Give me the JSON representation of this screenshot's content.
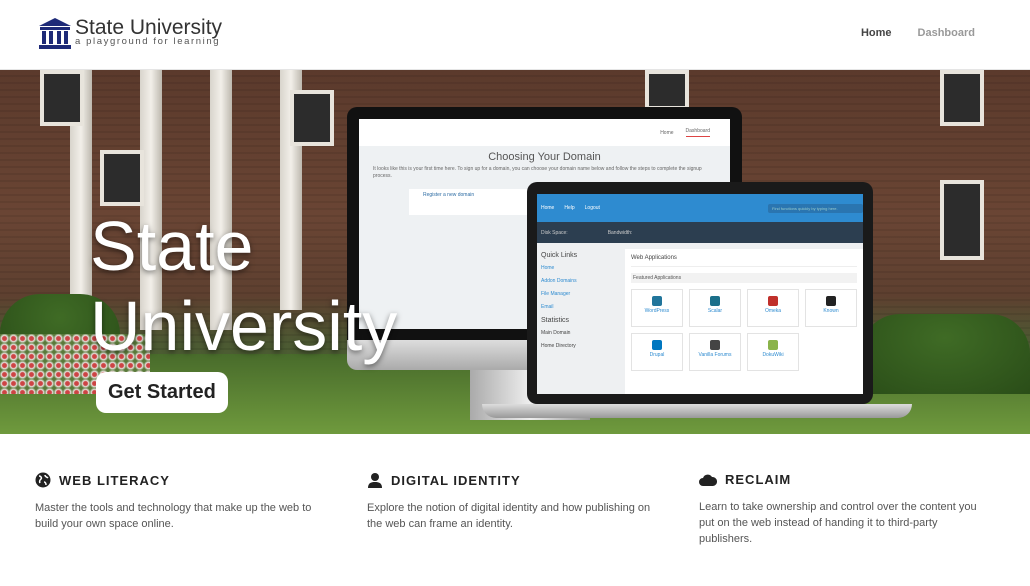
{
  "header": {
    "logo": {
      "title": "State University",
      "subtitle": "a playground for learning",
      "color": "#1e2a78"
    },
    "nav": [
      {
        "label": "Home",
        "active": true
      },
      {
        "label": "Dashboard",
        "active": false
      }
    ]
  },
  "hero": {
    "title_line1": "State",
    "title_line2": "University",
    "cta_label": "Get Started",
    "monitor": {
      "nav": [
        "Home",
        "Dashboard"
      ],
      "title": "Choosing Your Domain",
      "intro": "It looks like this is your first time here. To sign up for a domain, you can choose your domain name below and follow the steps to complete the signup process.",
      "option": "Register a new domain"
    },
    "laptop": {
      "nav": [
        "Home",
        "Help",
        "Logout"
      ],
      "search_placeholder": "Find functions quickly by typing here.",
      "disk_label": "Disk Space:",
      "bandwidth_label": "Bandwidth:",
      "quick_links_title": "Quick Links",
      "quick_links": [
        "Home",
        "Addon Domains",
        "File Manager",
        "Email"
      ],
      "statistics_title": "Statistics",
      "main_domain_label": "Main Domain",
      "home_directory_label": "Home Directory",
      "apps_title": "Web Applications",
      "featured_label": "Featured Applications",
      "apps": [
        {
          "name": "WordPress",
          "color": "#21759b"
        },
        {
          "name": "Scalar",
          "color": "#1b6f8a"
        },
        {
          "name": "Omeka",
          "color": "#c0302b"
        },
        {
          "name": "Known",
          "color": "#222"
        },
        {
          "name": "Drupal",
          "color": "#0077c0"
        },
        {
          "name": "Vanilla Forums",
          "color": "#444"
        },
        {
          "name": "DokuWiki",
          "color": "#8ab34a"
        }
      ]
    }
  },
  "features": [
    {
      "icon": "globe-icon",
      "title": "WEB LITERACY",
      "text": "Master the tools and technology that make up the web to build your own space online."
    },
    {
      "icon": "user-icon",
      "title": "DIGITAL IDENTITY",
      "text": "Explore the notion of digital identity and how publishing on the web can frame an identity."
    },
    {
      "icon": "cloud-icon",
      "title": "RECLAIM",
      "text": "Learn to take ownership and control over the content you put on the web instead of handing it to third-party publishers."
    }
  ]
}
